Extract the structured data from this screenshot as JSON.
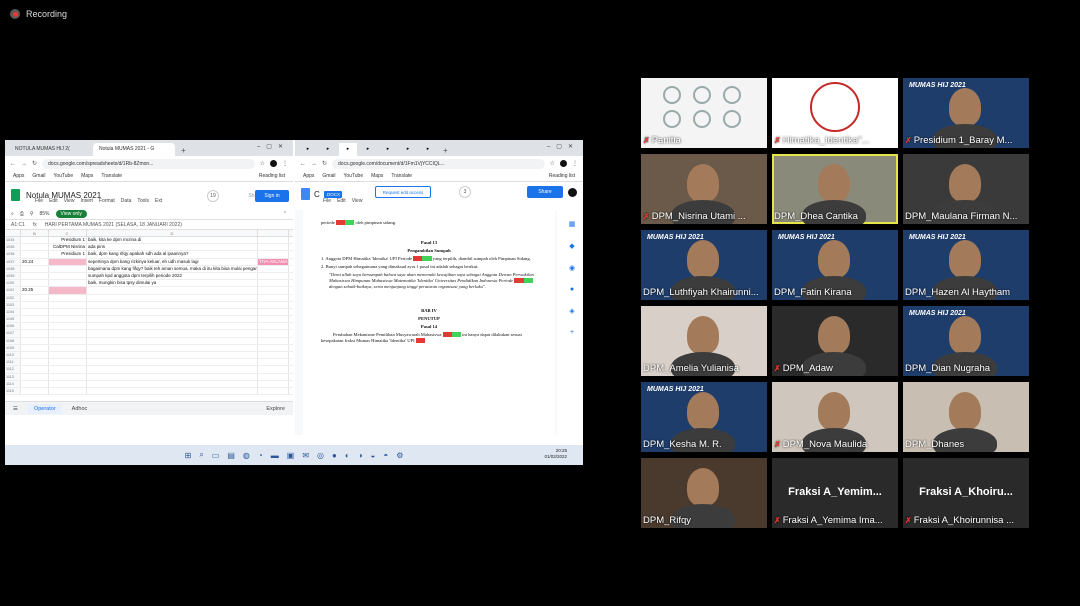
{
  "recording": {
    "label": "Recording"
  },
  "colors": {
    "accent": "#1a73e8",
    "speaking": "#e5e54a",
    "muted": "#e53935",
    "sheets_green": "#0f9d58"
  },
  "sheets_window": {
    "tabs": [
      "NOTULA MUMAS HIJ 2(",
      "Notula MUMAS 2021 - G"
    ],
    "url": "docs.google.com/spreadsheets/d/1Rb-8Zmon...",
    "bookmarks": [
      "Apps",
      "Gmail",
      "YouTube",
      "Maps",
      "Translate"
    ],
    "reading_list": "Reading list",
    "title": "Notula MUMAS 2021",
    "menu": [
      "File",
      "Edit",
      "View",
      "Insert",
      "Format",
      "Data",
      "Tools",
      "Ext"
    ],
    "user_count": "19",
    "share_label": "Share",
    "signin_label": "Sign in",
    "zoom": "85%",
    "view_only": "View only",
    "cell_ref": "A1:C1",
    "formula": "HARI PERTAMA MUMAS 2021 (SELASA, 18 JANUARI 2022)",
    "col_headers": [
      "",
      "B",
      "C",
      "D"
    ],
    "rows": [
      [
        "1034",
        "",
        "Presidium 1",
        "baik, kita ke dpm mcrina di",
        ""
      ],
      [
        "1035",
        "",
        "CalDPM Nisrina",
        "ada pins",
        ""
      ],
      [
        "1036",
        "",
        "Presidium 1",
        "baik, dpm kang rifqy apakah sdh ada al ipaannya?",
        ""
      ],
      [
        "1037",
        "20.24",
        "",
        "sepertinya dpm kang rizkinya keluar, eh udh masuk lagi",
        "TIYA AKLAMA"
      ],
      [
        "1038",
        "",
        "",
        "bagaimana dpm kang fifqy? baik teh aman semua. maka di itu kita bisa mulai pengambilan",
        ""
      ],
      [
        "1039",
        "",
        "",
        "sumpah kpd anggota dpm terpilih periode 2022",
        ""
      ],
      [
        "1100",
        "",
        "",
        "baik, mungkin bisa tpsy dimulai ya",
        ""
      ],
      [
        "1101",
        "20.25",
        "",
        "",
        ""
      ],
      [
        "1102",
        "",
        "",
        "",
        ""
      ],
      [
        "1103",
        "",
        "",
        "",
        ""
      ],
      [
        "1104",
        "",
        "",
        "",
        ""
      ],
      [
        "1105",
        "",
        "",
        "",
        ""
      ],
      [
        "1106",
        "",
        "",
        "",
        ""
      ],
      [
        "1107",
        "",
        "",
        "",
        ""
      ],
      [
        "1108",
        "",
        "",
        "",
        ""
      ],
      [
        "1109",
        "",
        "",
        "",
        ""
      ],
      [
        "1110",
        "",
        "",
        "",
        ""
      ],
      [
        "1111",
        "",
        "",
        "",
        ""
      ],
      [
        "1112",
        "",
        "",
        "",
        ""
      ],
      [
        "1113",
        "",
        "",
        "",
        ""
      ],
      [
        "1114",
        "",
        "",
        "",
        ""
      ],
      [
        "1115",
        "",
        "",
        "",
        ""
      ]
    ],
    "sheet_tabs": [
      "Operator",
      "Adhoc"
    ],
    "explore": "Explore"
  },
  "docs_window": {
    "url": "docs.google.com/document/d/1Fm1VjYCCIQL...",
    "bookmarks": [
      "Apps",
      "Gmail",
      "YouTube",
      "Maps",
      "Translate"
    ],
    "reading_list": "Reading list",
    "title": "C",
    "docx_badge": ".DOCX",
    "menu": [
      "File",
      "Edit",
      "View"
    ],
    "request_edit": "Request edit access",
    "user_count": "3",
    "share_label": "Share",
    "content": {
      "pasal13_title": "Pasal 13",
      "pasal13_subtitle": "Pengambilan Sumpah",
      "pasal13_p1": "1. Anggota DPM Himatika 'Identika' UPI Periode",
      "pasal13_p1b": "yang terpilih, diambil sumpah oleh Pimpinan Sidang.",
      "pasal13_p2": "2. Bunyi sumpah sebagaimana yang dimaksud ayat 1 pasal ini adalah sebagai berikut:",
      "pasal13_oath": "\"Demi allah saya bersumpah bahwa saya akan memenuhi kewajiban saya sebagai Anggota Dewan Perwakilan Mahasiswa Himpunan Mahasiswa Matematika 'Identika' Universitas Pendidikan Indonesia Periode",
      "pasal13_oath_end": "dengan sebaik-baiknya, serta menjunjung tinggi peraturan organisasi yang berlaku\".",
      "bab4_title": "BAB IV",
      "bab4_subtitle": "PENUTUP",
      "pasal14_title": "Pasal 14",
      "pasal14_text": "Perubahan Mekanisme Pemilihan Musyawarah Mahasiswa",
      "pasal14_text_b": "ini hanya dapat dilakukan sesuai kesepakatan fraksi Mumas Himatika 'Identika' UPI",
      "top_text": "periode",
      "top_text_b": "oleh pimpinan sidang."
    }
  },
  "taskbar": {
    "time": "20:25",
    "date": "01/02/2022"
  },
  "participants": [
    {
      "name": "Panitia",
      "muted": true
    },
    {
      "name": "Himatika_Identika\"...",
      "muted": true
    },
    {
      "name": "Presidium 1_Baray M...",
      "muted": true
    },
    {
      "name": "DPM_Nisrina Utami ...",
      "muted": true
    },
    {
      "name": "DPM_Dhea Cantika",
      "muted": false,
      "speaking": true
    },
    {
      "name": "DPM_Maulana Firman N...",
      "muted": false
    },
    {
      "name": "DPM_Luthfiyah Khairunni...",
      "muted": false
    },
    {
      "name": "DPM_Fatin Kirana",
      "muted": false
    },
    {
      "name": "DPM_Hazen Al Haytham",
      "muted": false
    },
    {
      "name": "DPM_Amelia Yulianisa",
      "muted": false
    },
    {
      "name": "DPM_Adaw",
      "muted": true
    },
    {
      "name": "DPM_Dian Nugraha",
      "muted": false
    },
    {
      "name": "DPM_Kesha M. R.",
      "muted": false
    },
    {
      "name": "DPM_Nova Maulida",
      "muted": true
    },
    {
      "name": "DPM_Dhanes",
      "muted": false
    },
    {
      "name": "DPM_Rifqy",
      "muted": false
    },
    {
      "name": "Fraksi A_Yemima Ima...",
      "muted": true,
      "display_name": "Fraksi  A_Yemim..."
    },
    {
      "name": "Fraksi A_Khoirunnisa ...",
      "muted": true,
      "display_name": "Fraksi  A_Khoiru..."
    }
  ],
  "banner": {
    "title": "MUMAS HIJ 2021"
  }
}
